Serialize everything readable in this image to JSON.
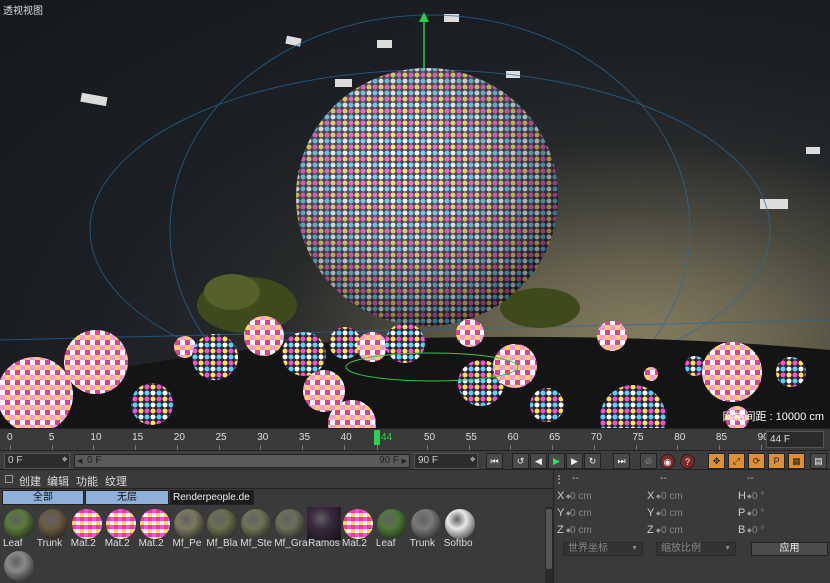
{
  "viewport": {
    "title": "透视视图",
    "info": "网格间距 : 10000 cm"
  },
  "timeline": {
    "ticks": [
      "0",
      "5",
      "10",
      "15",
      "20",
      "25",
      "30",
      "35",
      "40",
      "44",
      "50",
      "55",
      "60",
      "65",
      "70",
      "75",
      "80",
      "85",
      "90"
    ],
    "current_frame": "44",
    "end_field": "44 F"
  },
  "transport": {
    "start_field": "0 F",
    "range_start": "0 F",
    "range_end": "90 F",
    "max_field": "90 F"
  },
  "materials": {
    "menu": [
      "创建",
      "编辑",
      "功能",
      "纹理"
    ],
    "layers": [
      "全部",
      "无层",
      "Renderpeople.de"
    ],
    "items": [
      {
        "name": "Leaf",
        "color": "#5a7a3a"
      },
      {
        "name": "Trunk",
        "color": "#6b5a44"
      },
      {
        "name": "Mat.2",
        "color": "disco"
      },
      {
        "name": "Mat.2",
        "color": "disco"
      },
      {
        "name": "Mat.2",
        "color": "disco"
      },
      {
        "name": "Mf_Pe",
        "color": "#7b7a60"
      },
      {
        "name": "Mf_Bla",
        "color": "#6a7050"
      },
      {
        "name": "Mf_Ste",
        "color": "#6f7456"
      },
      {
        "name": "Mf_Gra",
        "color": "#6c6e58"
      },
      {
        "name": "Ramos",
        "color": "#3a2a40"
      },
      {
        "name": "Mat.2",
        "color": "disco"
      },
      {
        "name": "Leaf",
        "color": "#4f7a3a"
      },
      {
        "name": "Trunk",
        "color": "#7a7a78"
      },
      {
        "name": "Softbo",
        "color": "#e8e8e8"
      },
      {
        "name": "",
        "color": "#8a8a8a"
      }
    ]
  },
  "coords": {
    "headers": [
      "--",
      "--",
      "--"
    ],
    "rows": [
      {
        "a1": "X",
        "v1": "0 cm",
        "a2": "X",
        "v2": "0 cm",
        "a3": "H",
        "v3": "0 °"
      },
      {
        "a1": "Y",
        "v1": "0 cm",
        "a2": "Y",
        "v2": "0 cm",
        "a3": "P",
        "v3": "0 °"
      },
      {
        "a1": "Z",
        "v1": "0 cm",
        "a2": "Z",
        "v2": "0 cm",
        "a3": "B",
        "v3": "0 °"
      }
    ],
    "world_dropdown": "世界坐标",
    "scale_dropdown": "缩放比例",
    "apply_label": "应用"
  }
}
